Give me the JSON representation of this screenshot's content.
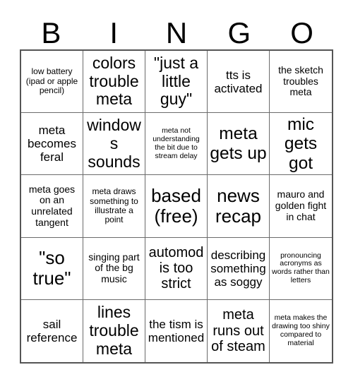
{
  "card": {
    "header_letters": [
      "B",
      "I",
      "N",
      "G",
      "O"
    ],
    "columns": 5,
    "rows": 5,
    "colors": {
      "background": "#ffffff",
      "text": "#000000",
      "grid_line": "#6b6b6b",
      "outer_border": "#555555"
    },
    "cells": [
      {
        "text": "low battery (ipad or apple pencil)",
        "size": "xs"
      },
      {
        "text": "colors trouble meta",
        "size": "xl"
      },
      {
        "text": "\"just a little guy\"",
        "size": "xl"
      },
      {
        "text": "tts is activated",
        "size": "m"
      },
      {
        "text": "the sketch troubles meta",
        "size": "s"
      },
      {
        "text": "meta becomes feral",
        "size": "m"
      },
      {
        "text": "windows sounds",
        "size": "xl"
      },
      {
        "text": "meta not understanding the bit due to stream delay",
        "size": "xxs"
      },
      {
        "text": "meta gets up",
        "size": "xxl"
      },
      {
        "text": "mic gets got",
        "size": "xxl"
      },
      {
        "text": "meta goes on an unrelated tangent",
        "size": "s"
      },
      {
        "text": "meta draws something to illustrate a point",
        "size": "xs"
      },
      {
        "text": "based (free)",
        "size": "xxl"
      },
      {
        "text": "news recap",
        "size": "xxl"
      },
      {
        "text": "mauro and golden fight in chat",
        "size": "s"
      },
      {
        "text": "\"so true\"",
        "size": "xxl"
      },
      {
        "text": "singing part of the bg music",
        "size": "s"
      },
      {
        "text": "automod is too strict",
        "size": "l"
      },
      {
        "text": "describing something as soggy",
        "size": "m"
      },
      {
        "text": "pronouncing acronyms as words rather than letters",
        "size": "xxs"
      },
      {
        "text": "sail reference",
        "size": "m"
      },
      {
        "text": "lines trouble meta",
        "size": "xl"
      },
      {
        "text": "the tism is mentioned",
        "size": "m"
      },
      {
        "text": "meta runs out of steam",
        "size": "l"
      },
      {
        "text": "meta makes the drawing too shiny compared to material",
        "size": "xxs"
      }
    ]
  }
}
